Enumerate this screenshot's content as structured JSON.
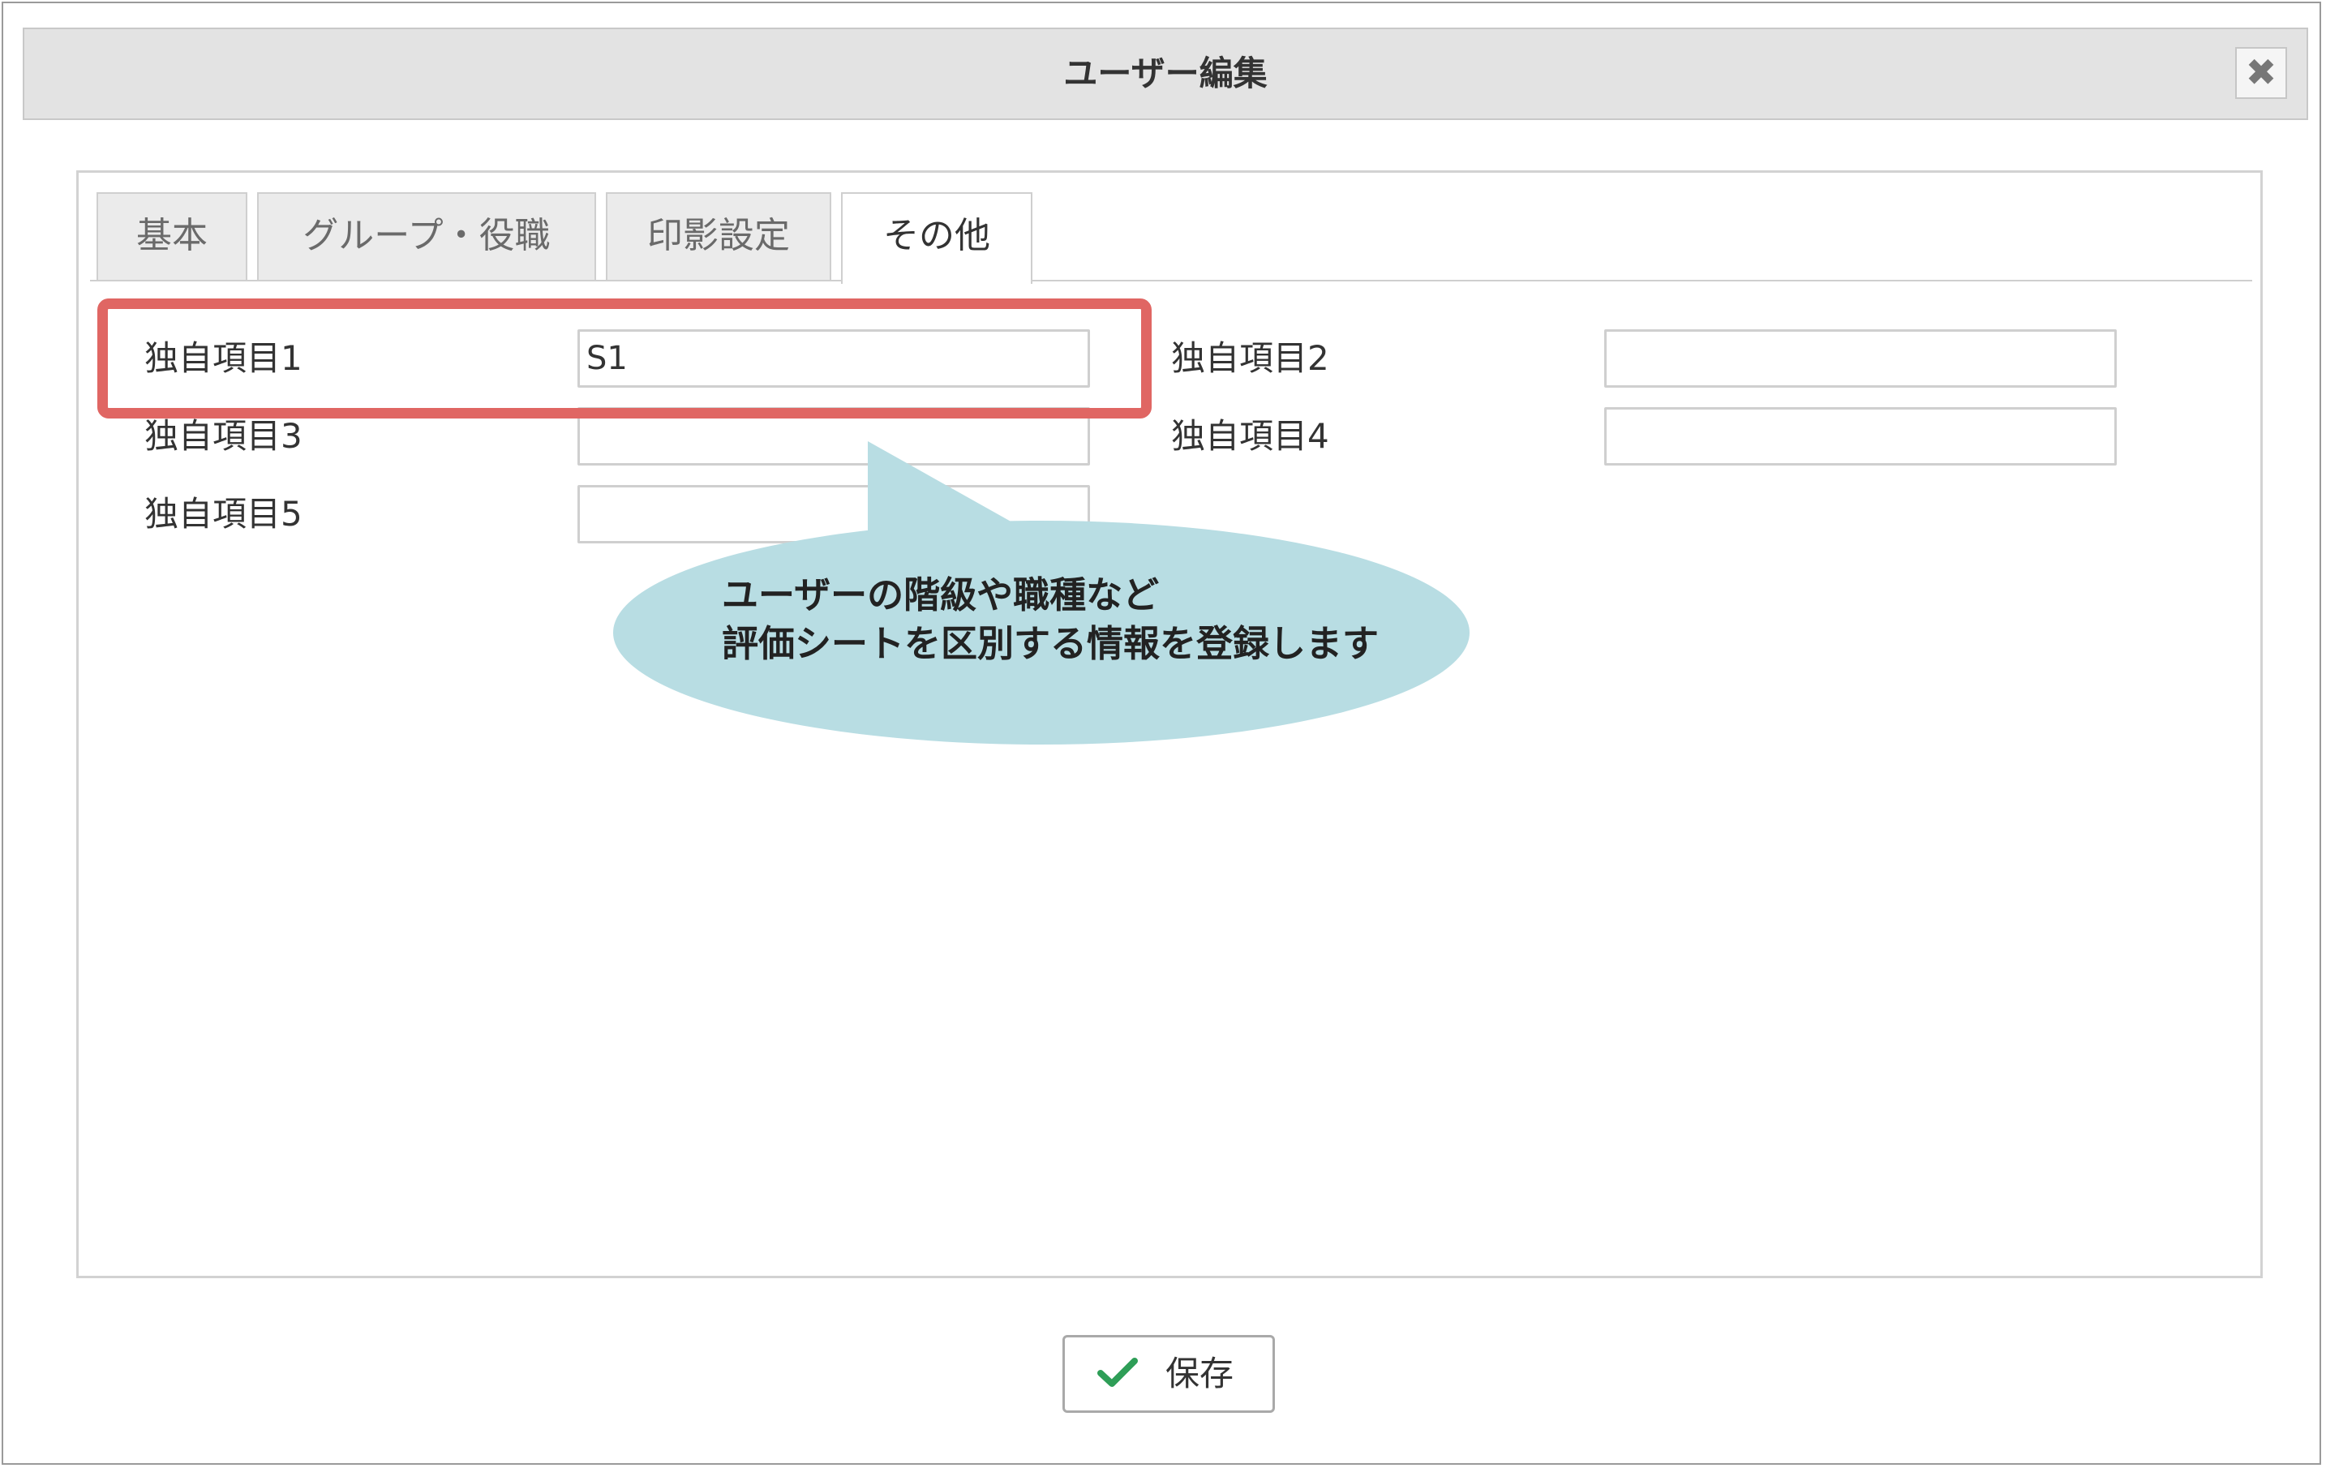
{
  "dialog": {
    "title": "ユーザー編集",
    "close_glyph": "✖"
  },
  "tabs": [
    {
      "label": "基本",
      "active": false
    },
    {
      "label": "グループ・役職",
      "active": false
    },
    {
      "label": "印影設定",
      "active": false
    },
    {
      "label": "その他",
      "active": true
    }
  ],
  "fields": [
    {
      "label": "独自項目1",
      "value": "S1",
      "highlighted": true
    },
    {
      "label": "独自項目2",
      "value": ""
    },
    {
      "label": "独自項目3",
      "value": ""
    },
    {
      "label": "独自項目4",
      "value": ""
    },
    {
      "label": "独自項目5",
      "value": ""
    }
  ],
  "callout": {
    "line1": "ユーザーの階級や職種など",
    "line2": "評価シートを区別する情報を登録します"
  },
  "save_button": {
    "label": "保存",
    "icon": "checkmark-icon"
  },
  "colors": {
    "highlight": "#e06663",
    "callout": "#b8dde3",
    "check": "#2e9e57",
    "titlebar": "#e3e3e3"
  }
}
